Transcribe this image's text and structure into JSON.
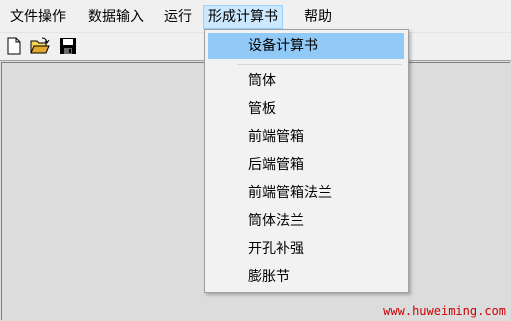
{
  "menubar": {
    "items": [
      {
        "label": "文件操作"
      },
      {
        "label": "数据输入"
      },
      {
        "label": "运行"
      },
      {
        "label": "形成计算书"
      },
      {
        "label": "帮助"
      }
    ]
  },
  "toolbar": {
    "buttons": [
      {
        "icon": "new-file-icon"
      },
      {
        "icon": "open-folder-icon"
      },
      {
        "icon": "save-disk-icon"
      }
    ]
  },
  "dropdown": {
    "items": [
      {
        "label": "设备计算书",
        "highlighted": true
      },
      {
        "label": "筒体"
      },
      {
        "label": "管板"
      },
      {
        "label": "前端管箱"
      },
      {
        "label": "后端管箱"
      },
      {
        "label": "前端管箱法兰"
      },
      {
        "label": "筒体法兰"
      },
      {
        "label": "开孔补强"
      },
      {
        "label": "膨胀节"
      }
    ]
  },
  "watermark": "www.huweiming.com",
  "colors": {
    "highlight": "#91c9f7",
    "menu_active": "#cce8ff",
    "watermark": "#cc0000"
  }
}
